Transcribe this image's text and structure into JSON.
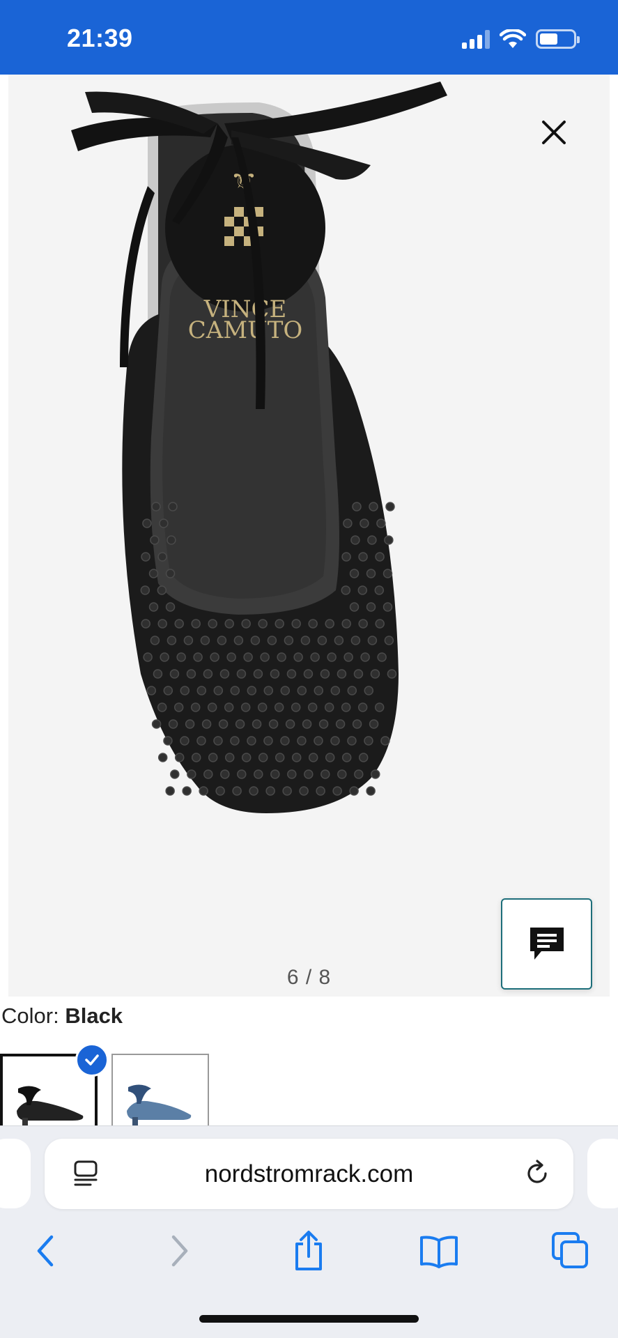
{
  "status_bar": {
    "time": "21:39",
    "icons": [
      "cellular-signal-icon",
      "wifi-icon",
      "battery-icon"
    ]
  },
  "gallery": {
    "counter": "6 / 8",
    "brand_mark_line1": "VINCE",
    "brand_mark_line2": "CAMUTO",
    "close_icon": "close-icon",
    "chat_icon": "chat-icon"
  },
  "product": {
    "color_label": "Color:",
    "color_value": "Black",
    "swatches": [
      {
        "name": "black",
        "selected": true
      },
      {
        "name": "blue",
        "selected": false
      }
    ]
  },
  "browser": {
    "url": "nordstromrack.com",
    "icons": [
      "reader-icon",
      "reload-icon",
      "back-icon",
      "forward-icon",
      "share-icon",
      "bookmarks-icon",
      "tabs-icon"
    ]
  },
  "colors": {
    "status_bar_bg": "#1a64d6",
    "accent_blue": "#1a64d6",
    "chat_border": "#1d6e7a"
  }
}
